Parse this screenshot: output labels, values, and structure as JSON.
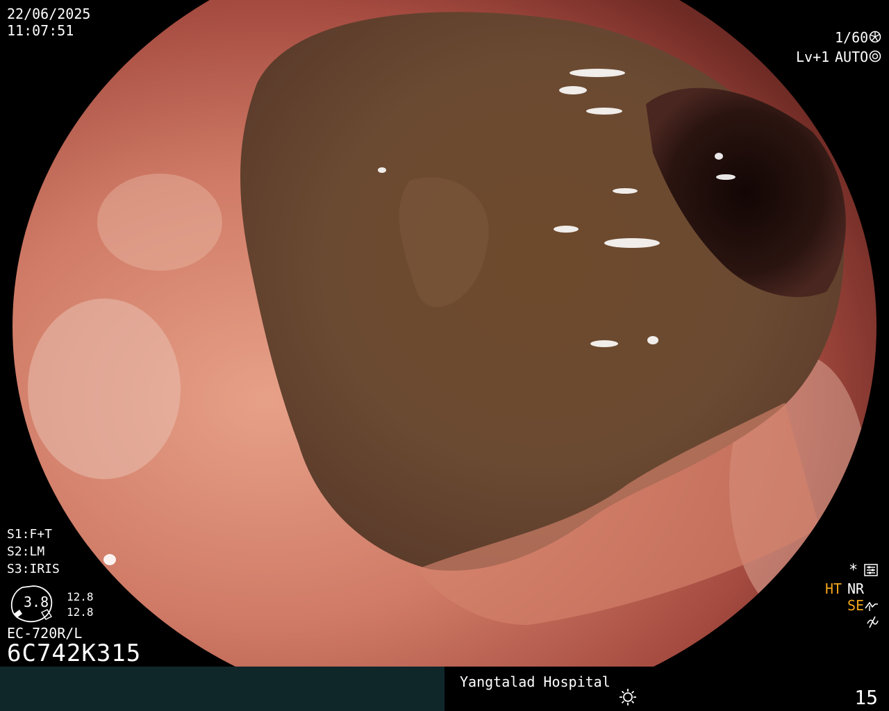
{
  "info": {
    "date": "22/06/2025",
    "time": "11:07:51",
    "shutter": "1/60",
    "level": "Lv+1",
    "iris_mode": "AUTO",
    "s1": "S1:F+T",
    "s2": "S2:LM",
    "s3": "S3:IRIS",
    "zoom_value": "3.8",
    "focal_1": "12.8",
    "focal_2": "12.8",
    "scope_model": "EC-720R/L",
    "serial": "6C742K315",
    "asterisk": "*",
    "ht": "HT",
    "nr": "NR",
    "se": "SE",
    "hospital": "Yangtalad Hospital",
    "frame_number": "15"
  },
  "icons": [
    "shutter-icon",
    "iris-auto-icon",
    "settings-grid-icon",
    "edge-enhance-icon",
    "flicker-icon",
    "brightness-icon"
  ],
  "colors": {
    "amber": "#f2a51c",
    "bar_left": "#10272a"
  }
}
